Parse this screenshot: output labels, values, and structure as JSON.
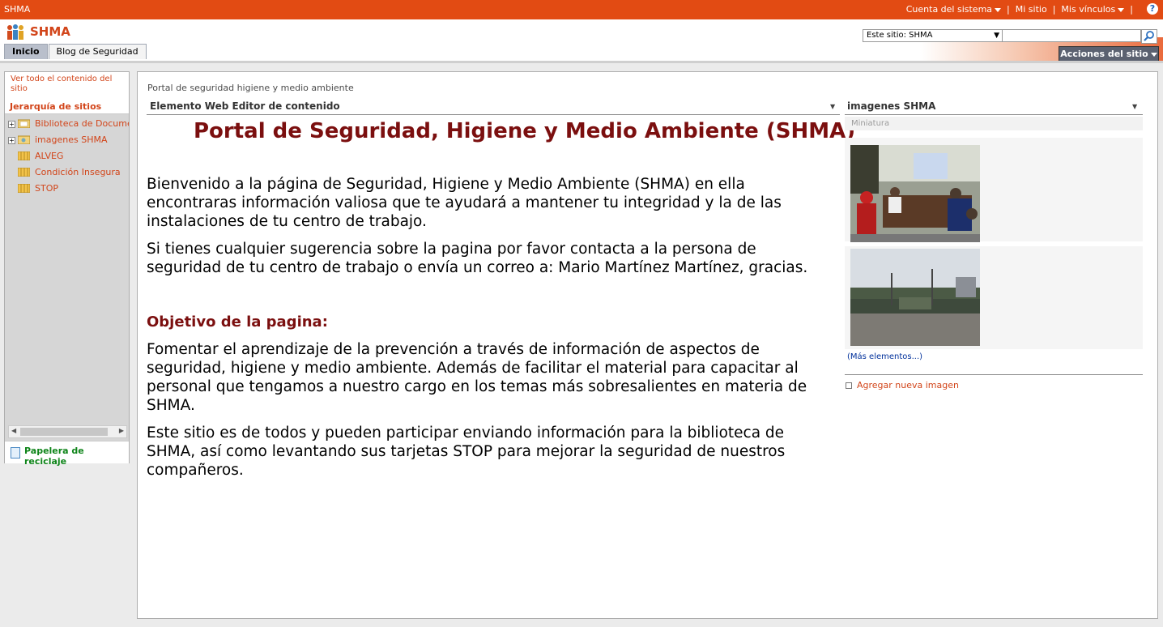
{
  "topbar": {
    "site_label": "SHMA",
    "links": [
      "Cuenta del sistema",
      "Mi sitio",
      "Mis vínculos"
    ],
    "help": "?"
  },
  "header": {
    "site_name": "SHMA",
    "tabs": [
      "Inicio",
      "Blog de Seguridad"
    ],
    "search_scope": "Este sitio: SHMA",
    "search_value": "",
    "site_actions": "Acciones del sitio"
  },
  "leftnav": {
    "view_all": "Ver todo el contenido del sitio",
    "hierarchy_title": "Jerarquía de sitios",
    "items": [
      {
        "label": "Biblioteca de Documentos"
      },
      {
        "label": "imagenes SHMA"
      },
      {
        "label": "ALVEG"
      },
      {
        "label": "Condición Insegura"
      },
      {
        "label": "STOP"
      }
    ],
    "recycle_bin": "Papelera de reciclaje"
  },
  "main": {
    "breadcrumb": "Portal de seguridad higiene y medio ambiente",
    "content_wp_title": "Elemento Web Editor de contenido",
    "page_title": "Portal de Seguridad, Higiene y Medio Ambiente (SHMA)",
    "para1": "Bienvenido a la página de Seguridad, Higiene y Medio Ambiente (SHMA) en ella encontraras información valiosa que te ayudará a mantener tu integridad y la de las instalaciones de tu centro de trabajo.",
    "para2": "Si tienes cualquier sugerencia sobre la pagina por favor contacta a la persona de seguridad de tu centro de trabajo o envía un correo a: Mario Martínez Martínez, gracias.",
    "objective_title": "Objetivo de la pagina:",
    "para3": "Fomentar el aprendizaje de la prevención a través de información de aspectos de seguridad, higiene y medio ambiente. Además de facilitar el material para capacitar al personal que tengamos a nuestro cargo en los temas más sobresalientes en materia de SHMA.",
    "para4": "Este sitio es de todos y pueden participar enviando información para la biblioteca de SHMA, así como levantando sus tarjetas STOP para mejorar la seguridad de nuestros compañeros."
  },
  "images_wp": {
    "title": "imagenes SHMA",
    "column": "Miniatura",
    "more": "(Más elementos...)",
    "add": "Agregar nueva imagen"
  },
  "colors": {
    "accent": "#e24b13",
    "link": "#d2451a",
    "heading": "#7b0f0f"
  }
}
